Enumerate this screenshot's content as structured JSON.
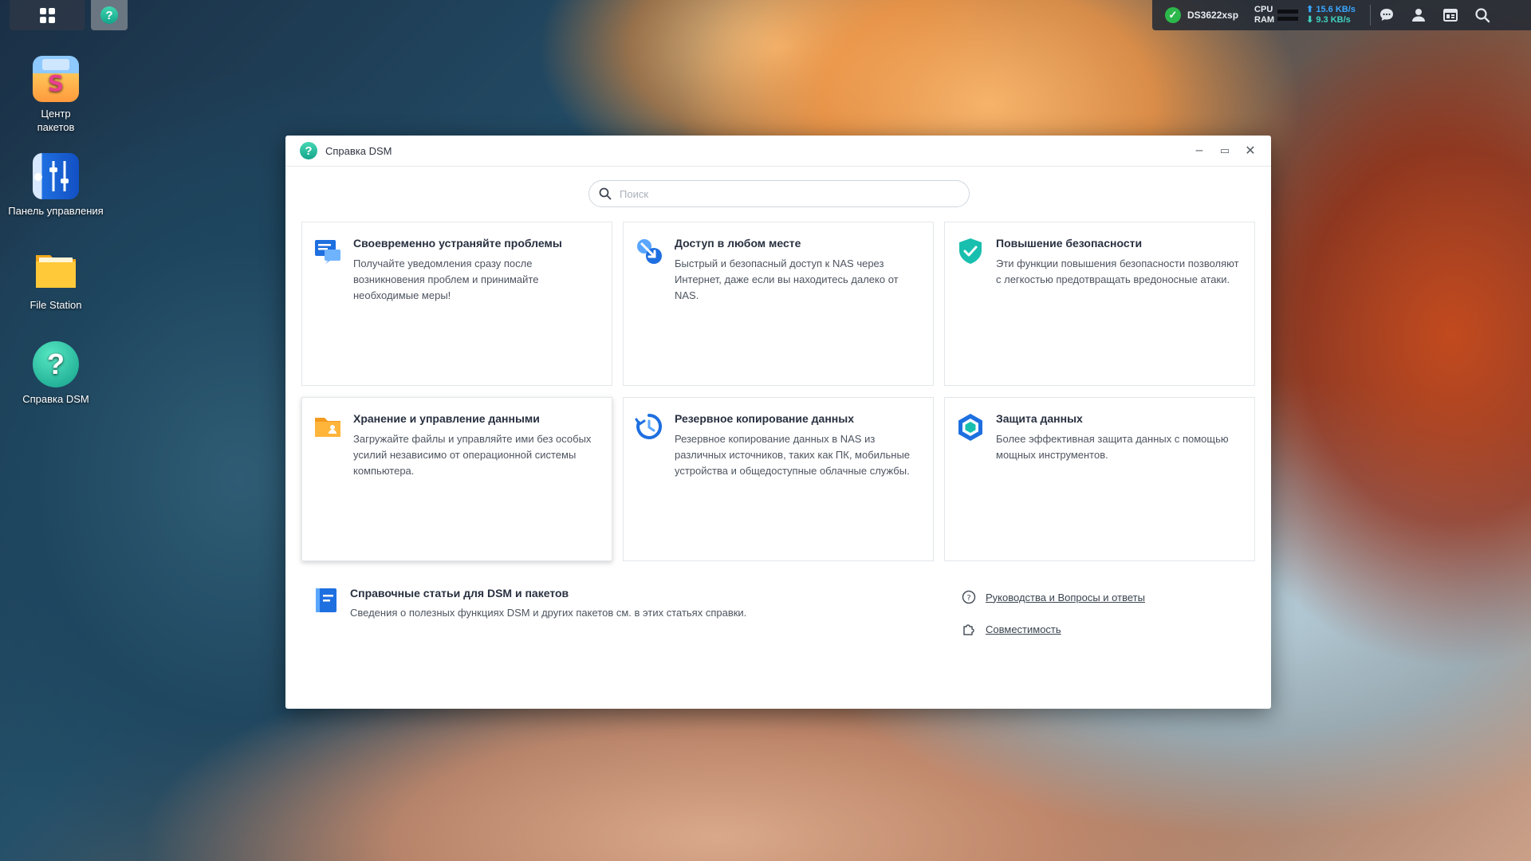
{
  "taskbar": {
    "main_menu_icon": "grid-icon",
    "help_app_icon": "help-icon",
    "help_app_glyph": "?"
  },
  "tray": {
    "status_icon": "check-icon",
    "host_name": "DS3622xsp",
    "cpu_label": "CPU",
    "ram_label": "RAM",
    "upload": "⬆ 15.6 KB/s",
    "download": "⬇ 9.3 KB/s",
    "icons": [
      "chat-icon",
      "user-icon",
      "widgets-icon",
      "search-icon"
    ]
  },
  "desktop": {
    "icons": [
      {
        "label": "Центр пакетов",
        "icon": "package-center-icon"
      },
      {
        "label": "Панель управления",
        "icon": "control-panel-icon"
      },
      {
        "label": "File Station",
        "icon": "folder-icon"
      },
      {
        "label": "Справка DSM",
        "icon": "help-icon"
      }
    ]
  },
  "window": {
    "title": "Справка DSM",
    "title_glyph": "?",
    "controls": {
      "minimize": "–",
      "maximize": "▭",
      "close": "✕"
    },
    "search": {
      "placeholder": "Поиск",
      "value": ""
    },
    "cards": [
      {
        "title": "Своевременно устраняйте проблемы",
        "desc": "Получайте уведомления сразу после возникновения проблем и принимайте необходимые меры!",
        "icon": "notification-icon"
      },
      {
        "title": "Доступ в любом месте",
        "desc": "Быстрый и безопасный доступ к NAS через Интернет, даже если вы находитесь далеко от NAS.",
        "icon": "remote-access-icon"
      },
      {
        "title": "Повышение безопасности",
        "desc": "Эти функции повышения безопасности позволяют с легкостью предотвращать вредоносные атаки.",
        "icon": "shield-check-icon"
      },
      {
        "title": "Хранение и управление данными",
        "desc": "Загружайте файлы и управляйте ими без особых усилий независимо от операционной системы компьютера.",
        "icon": "shared-folder-icon"
      },
      {
        "title": "Резервное копирование данных",
        "desc": "Резервное копирование данных в NAS из различных источников, таких как ПК, мобильные устройства и общедоступные облачные службы.",
        "icon": "backup-icon"
      },
      {
        "title": "Защита данных",
        "desc": "Более эффективная защита данных с помощью мощных инструментов.",
        "icon": "data-protection-icon"
      }
    ],
    "articles": {
      "title": "Справочные статьи для DSM и пакетов",
      "desc": "Сведения о полезных функциях DSM и других пакетов см. в этих статьях справки.",
      "icon": "book-icon"
    },
    "links": [
      {
        "label": "Руководства и Вопросы и ответы",
        "icon": "question-circle-icon"
      },
      {
        "label": "Совместимость",
        "icon": "puzzle-icon"
      }
    ]
  },
  "colors": {
    "accent_blue": "#2f7fe8",
    "accent_teal": "#1fc1b0",
    "accent_orange": "#f5a623",
    "text_dark": "#283040",
    "text_body": "#4d5560"
  }
}
